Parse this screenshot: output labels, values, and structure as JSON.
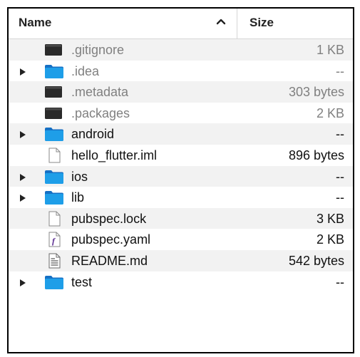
{
  "columns": {
    "name": "Name",
    "size": "Size"
  },
  "sort_icon": "chevron-up-icon",
  "colors": {
    "folder": "#1e9ee8",
    "terminal": "#2a2a2a",
    "alt_row": "#f2f2f2",
    "dim_text": "#808080",
    "yaml_f": "#5b2e91"
  },
  "files": [
    {
      "name": ".gitignore",
      "size": "1 KB",
      "icon": "terminal-file-icon",
      "folder": false,
      "dim": true
    },
    {
      "name": ".idea",
      "size": "--",
      "icon": "folder-icon",
      "folder": true,
      "dim": true
    },
    {
      "name": ".metadata",
      "size": "303 bytes",
      "icon": "terminal-file-icon",
      "folder": false,
      "dim": true
    },
    {
      "name": ".packages",
      "size": "2 KB",
      "icon": "terminal-file-icon",
      "folder": false,
      "dim": true
    },
    {
      "name": "android",
      "size": "--",
      "icon": "folder-icon",
      "folder": true,
      "dim": false
    },
    {
      "name": "hello_flutter.iml",
      "size": "896 bytes",
      "icon": "document-icon",
      "folder": false,
      "dim": false
    },
    {
      "name": "ios",
      "size": "--",
      "icon": "folder-icon",
      "folder": true,
      "dim": false
    },
    {
      "name": "lib",
      "size": "--",
      "icon": "folder-icon",
      "folder": true,
      "dim": false
    },
    {
      "name": "pubspec.lock",
      "size": "3 KB",
      "icon": "document-icon",
      "folder": false,
      "dim": false
    },
    {
      "name": "pubspec.yaml",
      "size": "2 KB",
      "icon": "yaml-file-icon",
      "folder": false,
      "dim": false
    },
    {
      "name": "README.md",
      "size": "542 bytes",
      "icon": "text-document-icon",
      "folder": false,
      "dim": false
    },
    {
      "name": "test",
      "size": "--",
      "icon": "folder-icon",
      "folder": true,
      "dim": false
    }
  ]
}
